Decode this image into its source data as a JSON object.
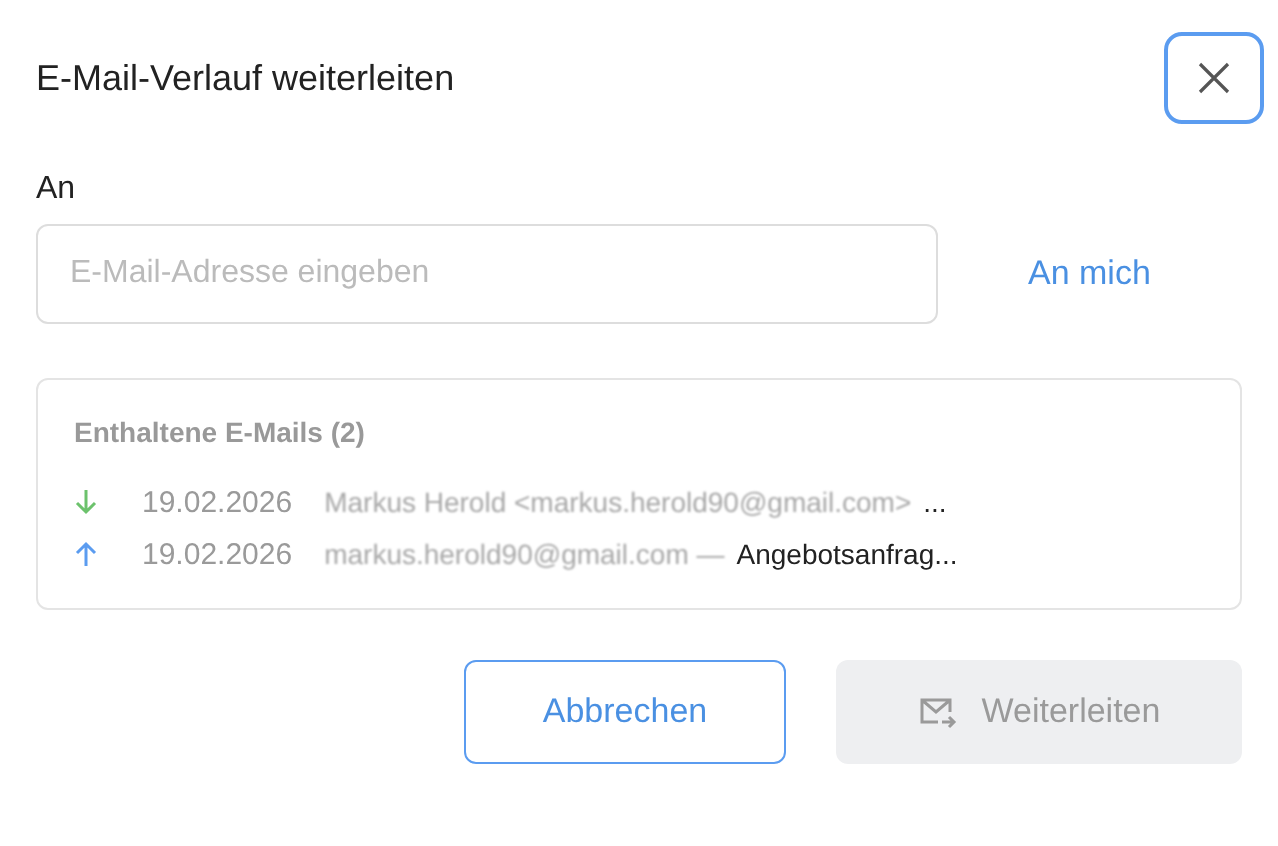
{
  "dialog": {
    "title": "E-Mail-Verlauf weiterleiten"
  },
  "recipient": {
    "label": "An",
    "placeholder": "E-Mail-Adresse eingeben",
    "link": "An mich"
  },
  "included": {
    "heading": "Enthaltene E-Mails (2)",
    "emails": [
      {
        "kind": "incoming",
        "date": "19.02.2026",
        "blurred": "Markus Herold <markus.herold90@gmail.com>",
        "rest": "..."
      },
      {
        "kind": "outgoing",
        "date": "19.02.2026",
        "blurred": "markus.herold90@gmail.com —",
        "rest": "Angebotsanfrag..."
      }
    ]
  },
  "buttons": {
    "cancel": "Abbrechen",
    "forward": {
      "label": "Weiterleiten",
      "disabled": true
    }
  }
}
